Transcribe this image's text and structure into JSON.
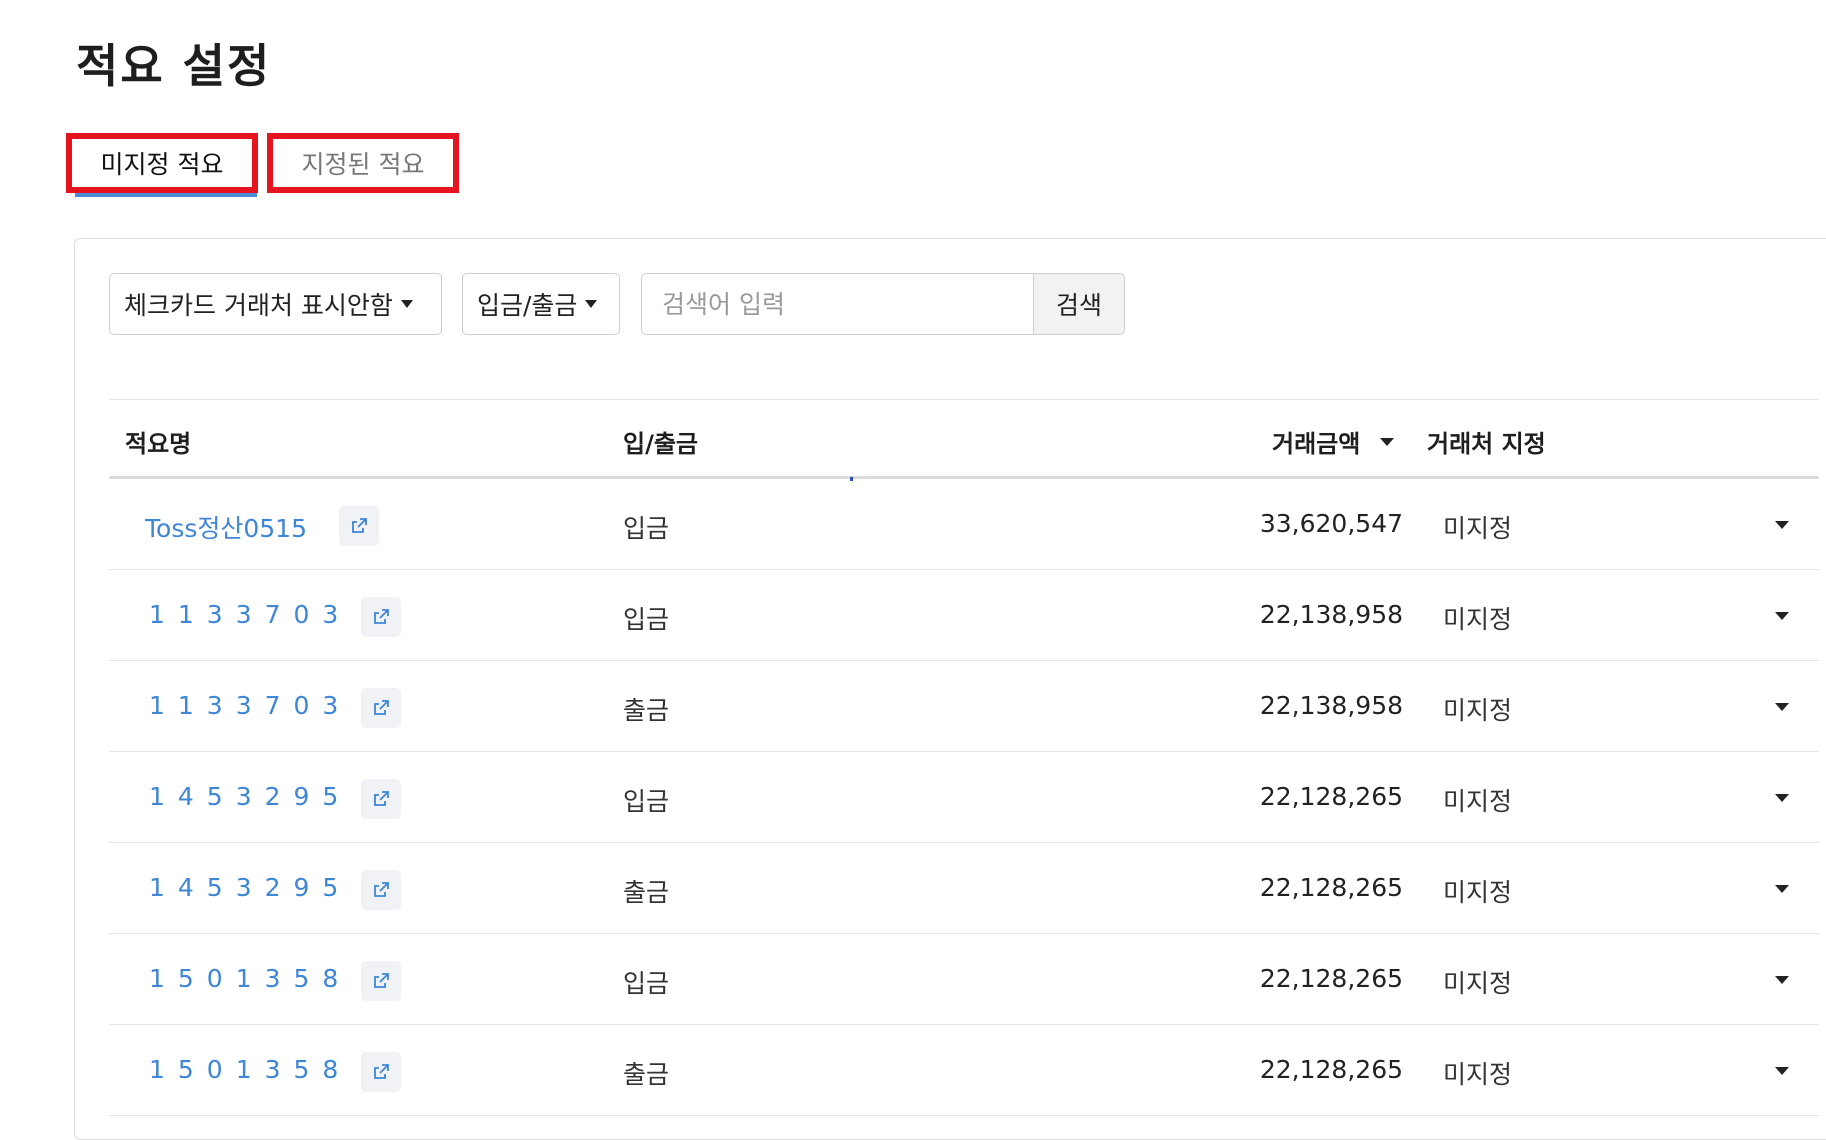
{
  "page": {
    "title": "적요 설정"
  },
  "tabs": [
    {
      "label": "미지정 적요",
      "active": true
    },
    {
      "label": "지정된 적요",
      "active": false
    }
  ],
  "filters": {
    "vendor_display": "체크카드 거래처 표시안함",
    "inout": "입금/출금",
    "search_placeholder": "검색어 입력",
    "search_button": "검색"
  },
  "table": {
    "headers": {
      "name": "적요명",
      "inout": "입/출금",
      "amount": "거래금액",
      "vendor": "거래처 지정"
    },
    "rows": [
      {
        "name": "Toss정산0515",
        "inout": "입금",
        "amount": "33,620,547",
        "vendor": "미지정"
      },
      {
        "name": "1133703",
        "inout": "입금",
        "amount": "22,138,958",
        "vendor": "미지정"
      },
      {
        "name": "1133703",
        "inout": "출금",
        "amount": "22,138,958",
        "vendor": "미지정"
      },
      {
        "name": "1453295",
        "inout": "입금",
        "amount": "22,128,265",
        "vendor": "미지정"
      },
      {
        "name": "1453295",
        "inout": "출금",
        "amount": "22,128,265",
        "vendor": "미지정"
      },
      {
        "name": "1501358",
        "inout": "입금",
        "amount": "22,128,265",
        "vendor": "미지정"
      },
      {
        "name": "1501358",
        "inout": "출금",
        "amount": "22,128,265",
        "vendor": "미지정"
      }
    ]
  },
  "colors": {
    "link": "#3e86d6",
    "highlight_border": "#e5141f",
    "tab_underline": "#4a8cd8"
  }
}
